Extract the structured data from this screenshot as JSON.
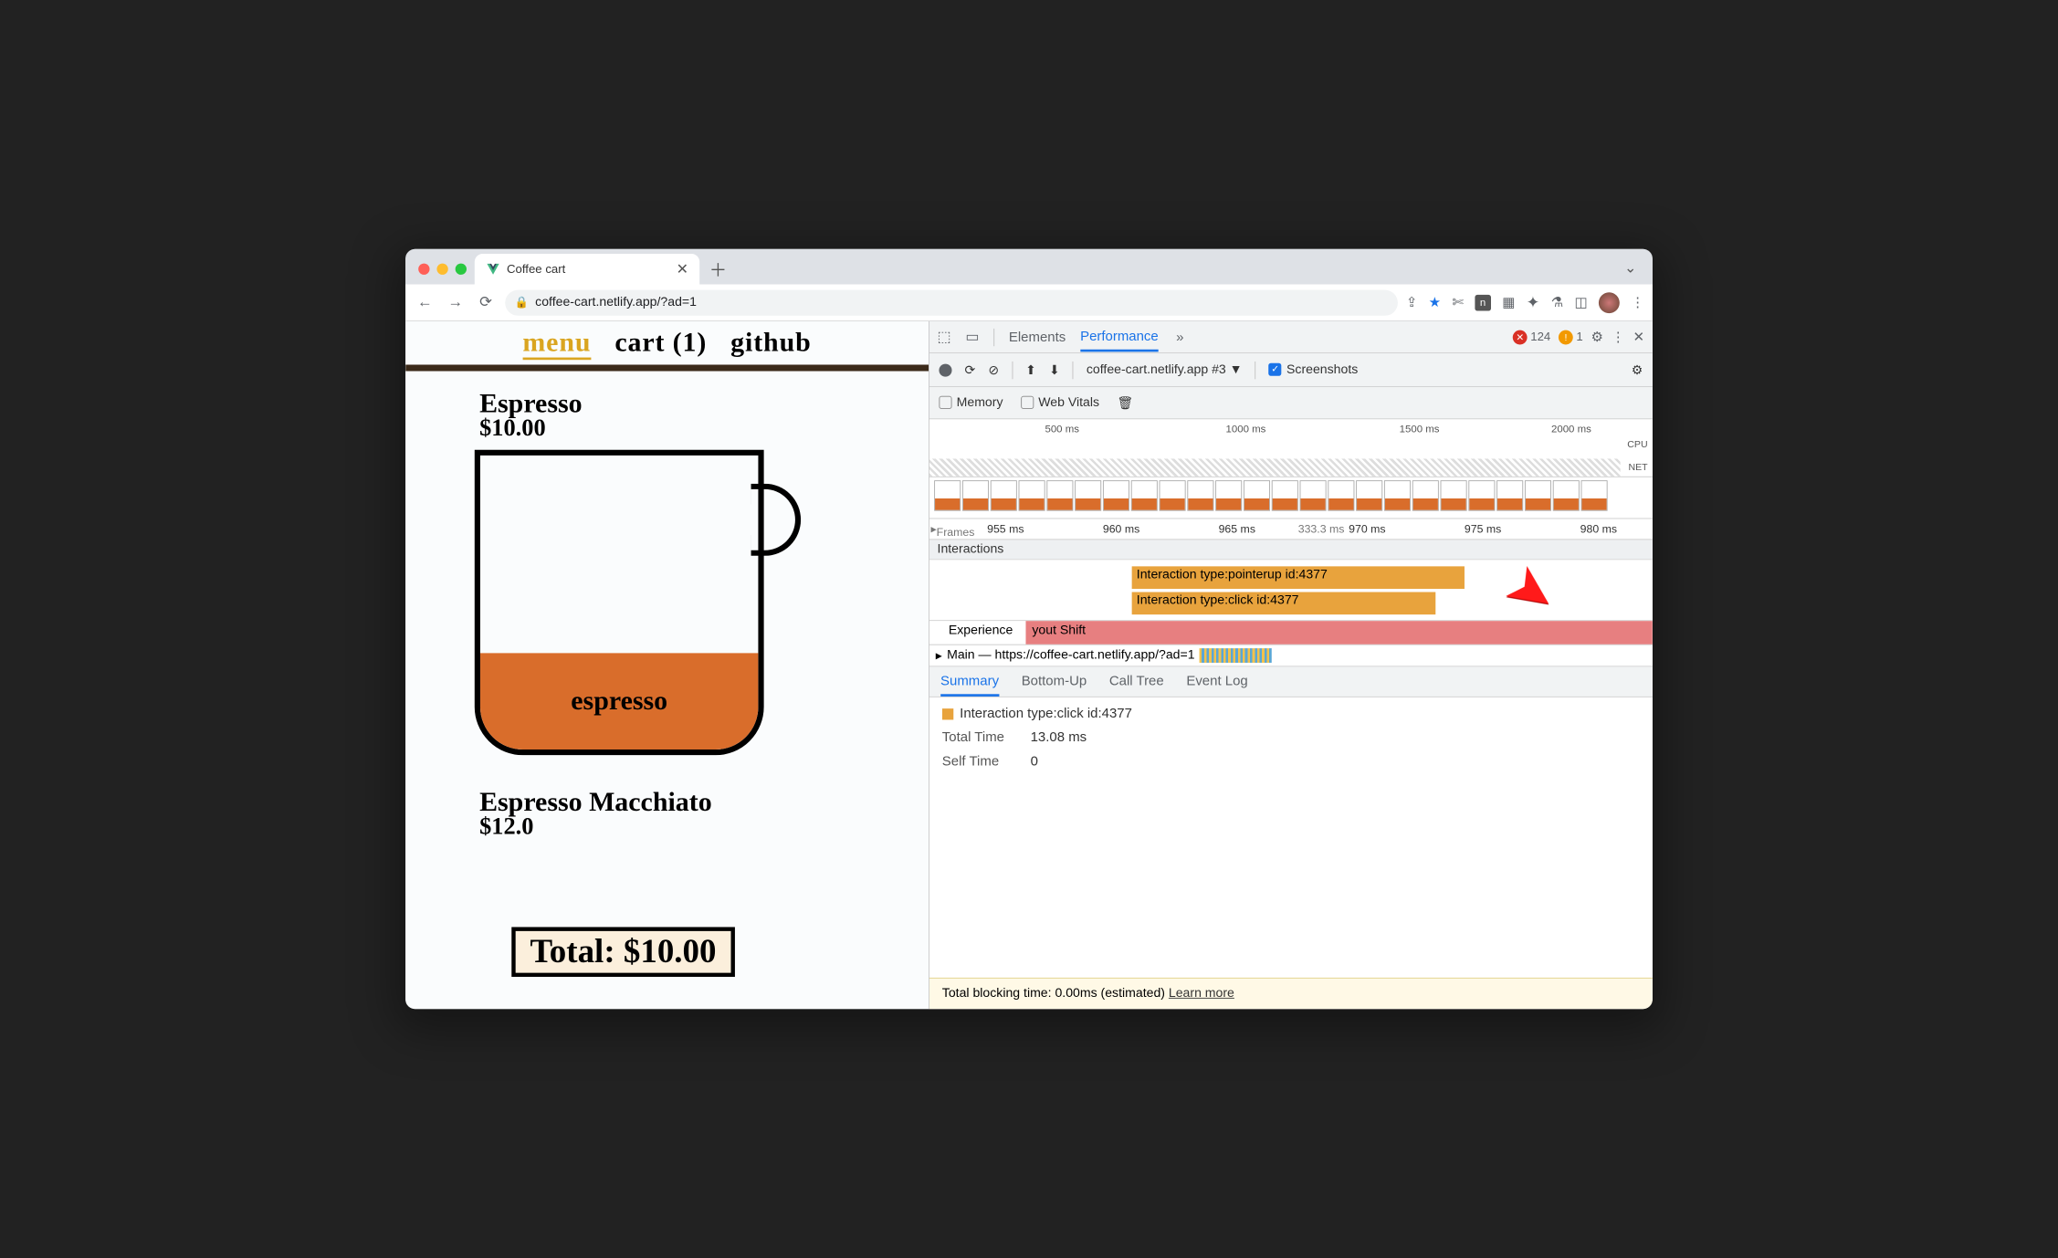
{
  "browser": {
    "tab_title": "Coffee cart",
    "url": "coffee-cart.netlify.app/?ad=1"
  },
  "page": {
    "nav": {
      "menu": "menu",
      "cart": "cart (1)",
      "github": "github"
    },
    "product1": {
      "name": "Espresso",
      "price": "$10.00",
      "fill_label": "espresso"
    },
    "product2": {
      "name": "Espresso Macchiato",
      "price": "$12.0"
    },
    "total_label": "Total: $10.00"
  },
  "devtools": {
    "tabs": {
      "elements": "Elements",
      "performance": "Performance",
      "more": "»"
    },
    "counts": {
      "errors": "124",
      "warnings": "1"
    },
    "perf_toolbar": {
      "recording_label": "coffee-cart.netlify.app #3",
      "screenshots": "Screenshots",
      "memory": "Memory",
      "web_vitals": "Web Vitals"
    },
    "overview_ticks": [
      "500 ms",
      "1000 ms",
      "1500 ms",
      "2000 ms"
    ],
    "overview_labels": {
      "cpu": "CPU",
      "net": "NET"
    },
    "ruler_ticks": [
      "955 ms",
      "960 ms",
      "965 ms",
      "970 ms",
      "975 ms",
      "980 ms"
    ],
    "ruler_dur": "333.3 ms",
    "frames_label": "Frames",
    "interactions_label": "Interactions",
    "interaction_bars": [
      "Interaction type:pointerup id:4377",
      "Interaction type:click id:4377"
    ],
    "experience_label": "Experience",
    "experience_shift_label": "yout Shift",
    "main_label": "Main — https://coffee-cart.netlify.app/?ad=1",
    "summary_tabs": {
      "summary": "Summary",
      "bottom_up": "Bottom-Up",
      "call_tree": "Call Tree",
      "event_log": "Event Log"
    },
    "summary": {
      "title": "Interaction type:click id:4377",
      "total_time_k": "Total Time",
      "total_time_v": "13.08 ms",
      "self_time_k": "Self Time",
      "self_time_v": "0"
    },
    "footer": {
      "text": "Total blocking time: 0.00ms (estimated)",
      "link": "Learn more"
    }
  }
}
